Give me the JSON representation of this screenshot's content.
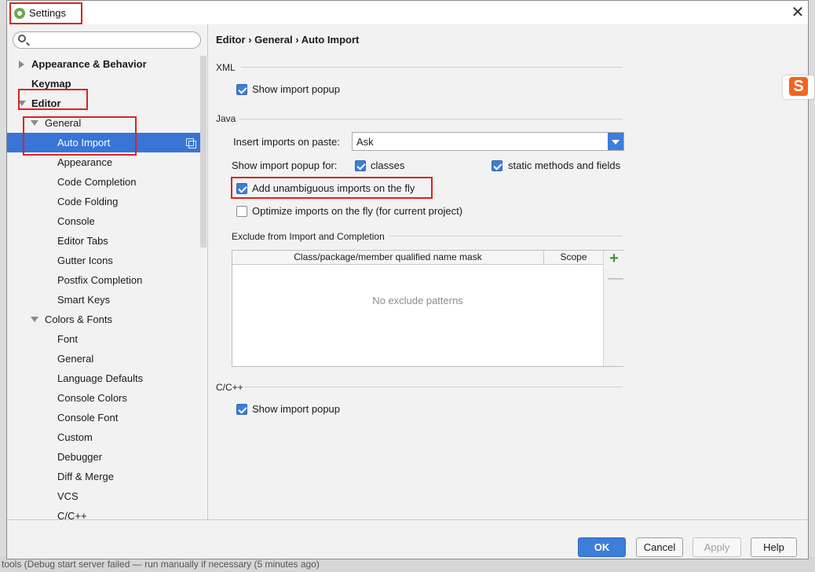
{
  "window": {
    "title": "Settings",
    "close_glyph": "✕"
  },
  "search": {
    "placeholder": ""
  },
  "sidebar": {
    "items": [
      {
        "label": "Appearance & Behavior"
      },
      {
        "label": "Keymap"
      },
      {
        "label": "Editor"
      },
      {
        "label": "General"
      },
      {
        "label": "Auto Import"
      },
      {
        "label": "Appearance"
      },
      {
        "label": "Code Completion"
      },
      {
        "label": "Code Folding"
      },
      {
        "label": "Console"
      },
      {
        "label": "Editor Tabs"
      },
      {
        "label": "Gutter Icons"
      },
      {
        "label": "Postfix Completion"
      },
      {
        "label": "Smart Keys"
      },
      {
        "label": "Colors & Fonts"
      },
      {
        "label": "Font"
      },
      {
        "label": "General"
      },
      {
        "label": "Language Defaults"
      },
      {
        "label": "Console Colors"
      },
      {
        "label": "Console Font"
      },
      {
        "label": "Custom"
      },
      {
        "label": "Debugger"
      },
      {
        "label": "Diff & Merge"
      },
      {
        "label": "VCS"
      },
      {
        "label": "C/C++"
      }
    ]
  },
  "breadcrumb": {
    "part1": "Editor",
    "part2": "General",
    "part3": "Auto Import",
    "sep": "›"
  },
  "xml": {
    "title": "XML",
    "show_popup": {
      "label": "Show import popup",
      "checked": true
    }
  },
  "java": {
    "title": "Java",
    "insert_label": "Insert imports on paste:",
    "insert_value": "Ask",
    "show_popup_for_label": "Show import popup for:",
    "classes": {
      "label": "classes",
      "checked": true
    },
    "static": {
      "label": "static methods and fields",
      "checked": true
    },
    "unambiguous": {
      "label": "Add unambiguous imports on the fly",
      "checked": true
    },
    "optimize": {
      "label": "Optimize imports on the fly (for current project)",
      "checked": false
    }
  },
  "exclude": {
    "title": "Exclude from Import and Completion",
    "col1": "Class/package/member qualified name mask",
    "col2": "Scope",
    "empty": "No exclude patterns",
    "add_glyph": "+",
    "remove_glyph": "—"
  },
  "cpp": {
    "title": "C/C++",
    "show_popup": {
      "label": "Show import popup",
      "checked": true
    }
  },
  "buttons": {
    "ok": "OK",
    "cancel": "Cancel",
    "apply": "Apply",
    "help": "Help"
  },
  "sogou": {
    "glyph": "S"
  },
  "colors": {
    "accent": "#3d7ed8",
    "selection": "#3875d6",
    "highlight_box": "#e02020"
  },
  "background_status": {
    "text": "tools (Debug start server failed — run manually if necessary (5 minutes ago)"
  }
}
